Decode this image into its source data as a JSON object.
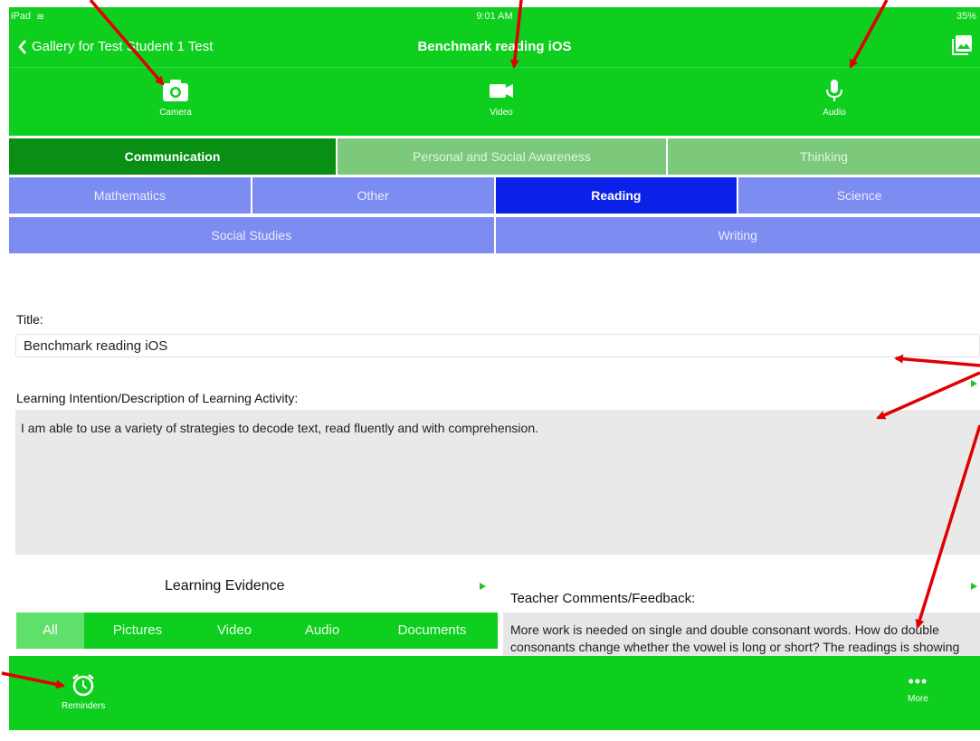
{
  "status_bar": {
    "carrier": "iPad",
    "time": "9:01 AM",
    "battery": "35%"
  },
  "nav": {
    "back_label": "Gallery for Test Student 1 Test",
    "title": "Benchmark reading iOS"
  },
  "media_buttons": {
    "camera": "Camera",
    "video": "Video",
    "audio": "Audio"
  },
  "core_competencies": {
    "items": [
      "Communication",
      "Personal and Social Awareness",
      "Thinking"
    ],
    "selected": "Communication"
  },
  "subjects": {
    "row1": [
      "Mathematics",
      "Other",
      "Reading",
      "Science"
    ],
    "row2": [
      "Social Studies",
      "Writing"
    ],
    "selected": "Reading"
  },
  "form": {
    "title_label": "Title:",
    "title_value": "Benchmark reading iOS",
    "intention_label": "Learning Intention/Description of Learning Activity:",
    "intention_value": "I am able to use a variety of strategies to decode text, read fluently and with comprehension."
  },
  "evidence": {
    "title": "Learning Evidence",
    "tabs": [
      "All",
      "Pictures",
      "Video",
      "Audio",
      "Documents"
    ],
    "selected": "All"
  },
  "feedback": {
    "label": "Teacher Comments/Feedback:",
    "text": "More work is needed on single and double consonant words. How do double consonants change whether the vowel is long or short?  The readings is showing growth with natural rhythm"
  },
  "tab_bar": {
    "reminders": "Reminders",
    "more": "More"
  },
  "colors": {
    "primary_green": "#0ecf1e",
    "dark_green": "#0a8f15",
    "selected_blue": "#0a22e8",
    "annotation_red": "#e00000"
  }
}
